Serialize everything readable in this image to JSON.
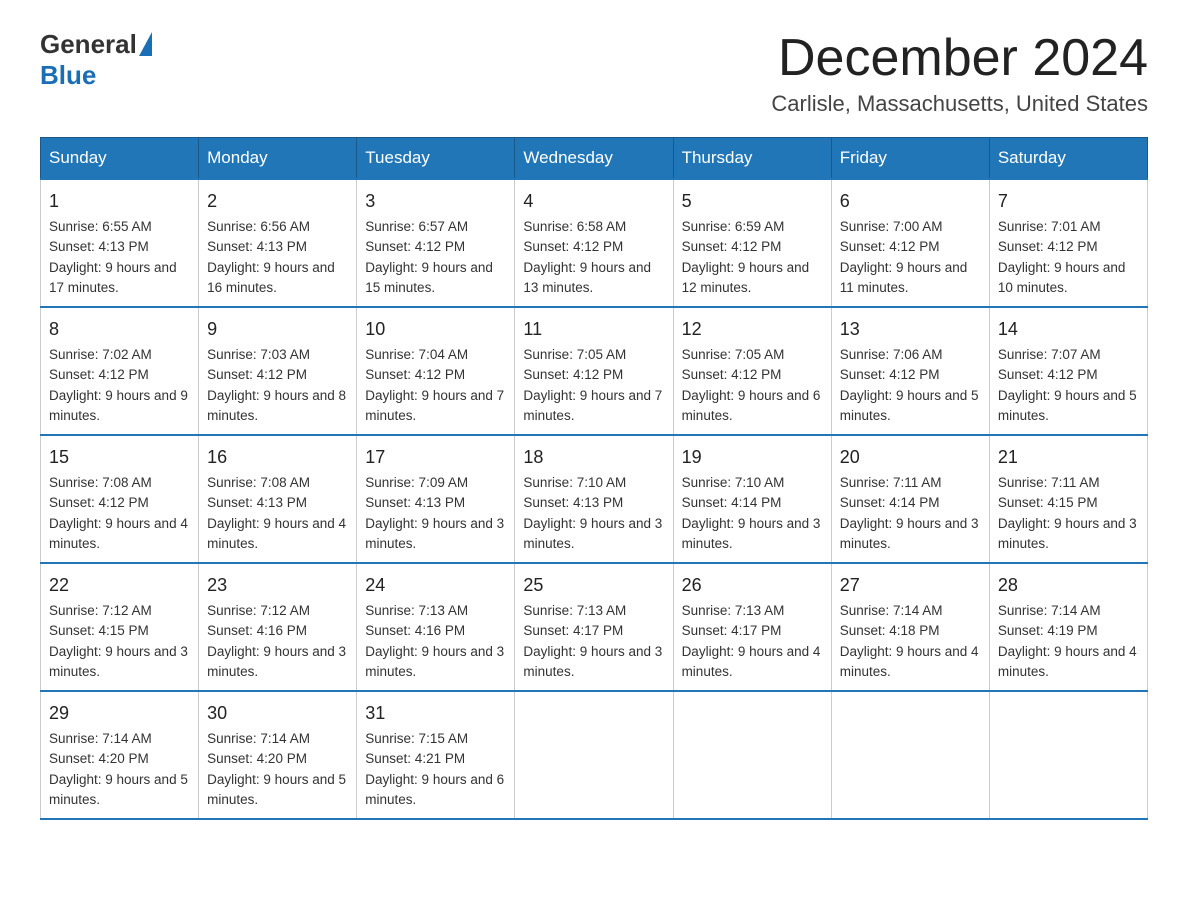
{
  "header": {
    "logo_general": "General",
    "logo_blue": "Blue",
    "month_title": "December 2024",
    "location": "Carlisle, Massachusetts, United States"
  },
  "days_of_week": [
    "Sunday",
    "Monday",
    "Tuesday",
    "Wednesday",
    "Thursday",
    "Friday",
    "Saturday"
  ],
  "weeks": [
    [
      {
        "day": "1",
        "sunrise": "6:55 AM",
        "sunset": "4:13 PM",
        "daylight": "9 hours and 17 minutes."
      },
      {
        "day": "2",
        "sunrise": "6:56 AM",
        "sunset": "4:13 PM",
        "daylight": "9 hours and 16 minutes."
      },
      {
        "day": "3",
        "sunrise": "6:57 AM",
        "sunset": "4:12 PM",
        "daylight": "9 hours and 15 minutes."
      },
      {
        "day": "4",
        "sunrise": "6:58 AM",
        "sunset": "4:12 PM",
        "daylight": "9 hours and 13 minutes."
      },
      {
        "day": "5",
        "sunrise": "6:59 AM",
        "sunset": "4:12 PM",
        "daylight": "9 hours and 12 minutes."
      },
      {
        "day": "6",
        "sunrise": "7:00 AM",
        "sunset": "4:12 PM",
        "daylight": "9 hours and 11 minutes."
      },
      {
        "day": "7",
        "sunrise": "7:01 AM",
        "sunset": "4:12 PM",
        "daylight": "9 hours and 10 minutes."
      }
    ],
    [
      {
        "day": "8",
        "sunrise": "7:02 AM",
        "sunset": "4:12 PM",
        "daylight": "9 hours and 9 minutes."
      },
      {
        "day": "9",
        "sunrise": "7:03 AM",
        "sunset": "4:12 PM",
        "daylight": "9 hours and 8 minutes."
      },
      {
        "day": "10",
        "sunrise": "7:04 AM",
        "sunset": "4:12 PM",
        "daylight": "9 hours and 7 minutes."
      },
      {
        "day": "11",
        "sunrise": "7:05 AM",
        "sunset": "4:12 PM",
        "daylight": "9 hours and 7 minutes."
      },
      {
        "day": "12",
        "sunrise": "7:05 AM",
        "sunset": "4:12 PM",
        "daylight": "9 hours and 6 minutes."
      },
      {
        "day": "13",
        "sunrise": "7:06 AM",
        "sunset": "4:12 PM",
        "daylight": "9 hours and 5 minutes."
      },
      {
        "day": "14",
        "sunrise": "7:07 AM",
        "sunset": "4:12 PM",
        "daylight": "9 hours and 5 minutes."
      }
    ],
    [
      {
        "day": "15",
        "sunrise": "7:08 AM",
        "sunset": "4:12 PM",
        "daylight": "9 hours and 4 minutes."
      },
      {
        "day": "16",
        "sunrise": "7:08 AM",
        "sunset": "4:13 PM",
        "daylight": "9 hours and 4 minutes."
      },
      {
        "day": "17",
        "sunrise": "7:09 AM",
        "sunset": "4:13 PM",
        "daylight": "9 hours and 3 minutes."
      },
      {
        "day": "18",
        "sunrise": "7:10 AM",
        "sunset": "4:13 PM",
        "daylight": "9 hours and 3 minutes."
      },
      {
        "day": "19",
        "sunrise": "7:10 AM",
        "sunset": "4:14 PM",
        "daylight": "9 hours and 3 minutes."
      },
      {
        "day": "20",
        "sunrise": "7:11 AM",
        "sunset": "4:14 PM",
        "daylight": "9 hours and 3 minutes."
      },
      {
        "day": "21",
        "sunrise": "7:11 AM",
        "sunset": "4:15 PM",
        "daylight": "9 hours and 3 minutes."
      }
    ],
    [
      {
        "day": "22",
        "sunrise": "7:12 AM",
        "sunset": "4:15 PM",
        "daylight": "9 hours and 3 minutes."
      },
      {
        "day": "23",
        "sunrise": "7:12 AM",
        "sunset": "4:16 PM",
        "daylight": "9 hours and 3 minutes."
      },
      {
        "day": "24",
        "sunrise": "7:13 AM",
        "sunset": "4:16 PM",
        "daylight": "9 hours and 3 minutes."
      },
      {
        "day": "25",
        "sunrise": "7:13 AM",
        "sunset": "4:17 PM",
        "daylight": "9 hours and 3 minutes."
      },
      {
        "day": "26",
        "sunrise": "7:13 AM",
        "sunset": "4:17 PM",
        "daylight": "9 hours and 4 minutes."
      },
      {
        "day": "27",
        "sunrise": "7:14 AM",
        "sunset": "4:18 PM",
        "daylight": "9 hours and 4 minutes."
      },
      {
        "day": "28",
        "sunrise": "7:14 AM",
        "sunset": "4:19 PM",
        "daylight": "9 hours and 4 minutes."
      }
    ],
    [
      {
        "day": "29",
        "sunrise": "7:14 AM",
        "sunset": "4:20 PM",
        "daylight": "9 hours and 5 minutes."
      },
      {
        "day": "30",
        "sunrise": "7:14 AM",
        "sunset": "4:20 PM",
        "daylight": "9 hours and 5 minutes."
      },
      {
        "day": "31",
        "sunrise": "7:15 AM",
        "sunset": "4:21 PM",
        "daylight": "9 hours and 6 minutes."
      },
      null,
      null,
      null,
      null
    ]
  ]
}
